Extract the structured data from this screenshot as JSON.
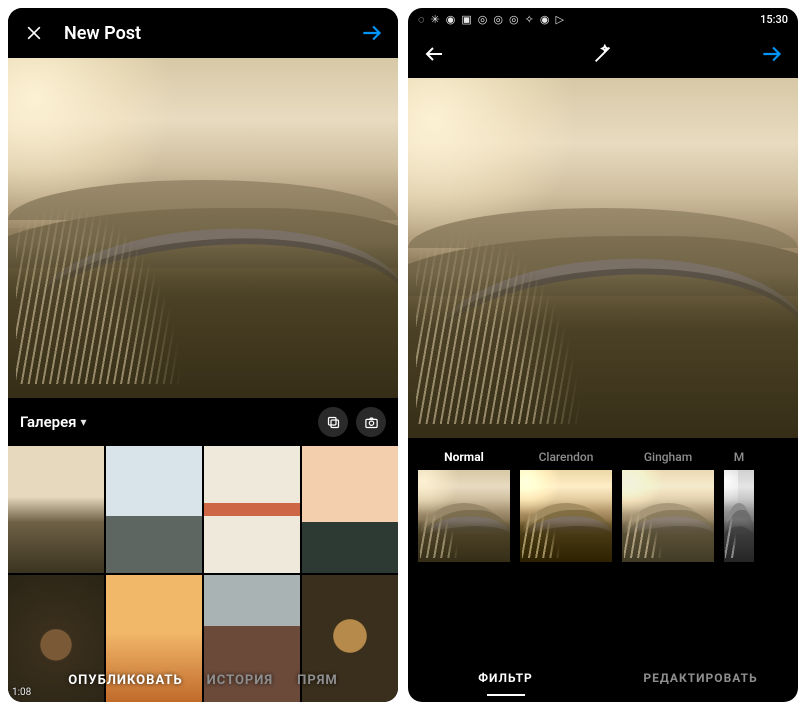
{
  "left": {
    "title": "New Post",
    "gallery_label": "Галерея",
    "thumb_badge": "1:08",
    "tabs": {
      "publish": "ОПУБЛИКОВАТЬ",
      "story": "ИСТОРИЯ",
      "live": "ПРЯМ"
    }
  },
  "right": {
    "status": {
      "time": "15:30"
    },
    "filters": [
      {
        "name": "Normal",
        "cls": "",
        "selected": true
      },
      {
        "name": "Clarendon",
        "cls": "f-clarendon",
        "selected": false
      },
      {
        "name": "Gingham",
        "cls": "f-gingham",
        "selected": false
      },
      {
        "name": "M",
        "cls": "f-mono",
        "selected": false
      }
    ],
    "tabs": {
      "filter": "ФИЛЬТР",
      "edit": "РЕДАКТИРОВАТЬ"
    }
  }
}
